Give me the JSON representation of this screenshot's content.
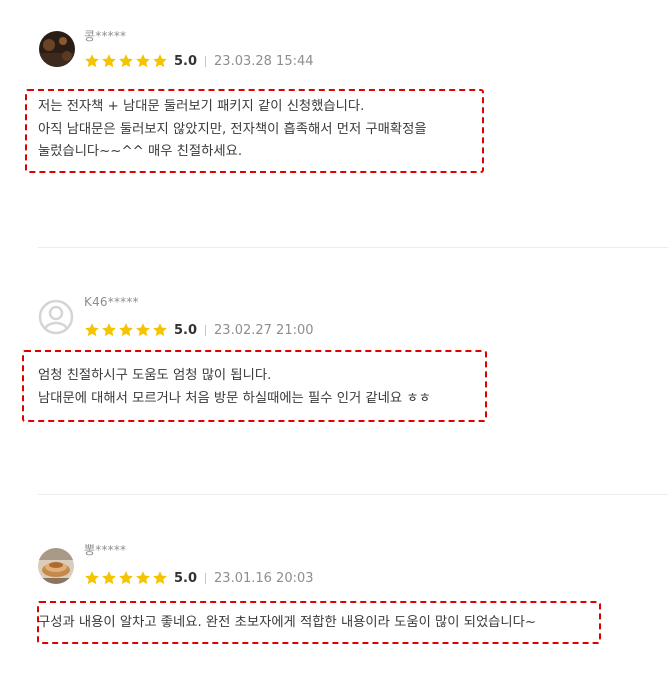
{
  "reviews": [
    {
      "user": "콩*****",
      "avatar": "photo-avatar-icon",
      "rating": 5,
      "score": "5.0",
      "date": "23.03.28 15:44",
      "lines": [
        "저는 전자책 + 남대문 둘러보기 패키지 같이 신청했습니다.",
        "아직 남대문은 둘러보지 않았지만, 전자책이 흡족해서 먼저 구매확정을",
        "눌렀습니다~~^^ 매우 친절하세요."
      ]
    },
    {
      "user": "K46*****",
      "avatar": "default-user-icon",
      "rating": 5,
      "score": "5.0",
      "date": "23.02.27 21:00",
      "lines": [
        "엄청 친절하시구 도움도 엄청 많이 됩니다.",
        "남대문에 대해서 모르거나 처음 방문 하실때에는 필수 인거 같네요 ㅎㅎ"
      ]
    },
    {
      "user": "뽕*****",
      "avatar": "photo-avatar-icon",
      "rating": 5,
      "score": "5.0",
      "date": "23.01.16 20:03",
      "lines": [
        "구성과 내용이 알차고 좋네요. 완전 초보자에게 적합한 내용이라 도움이 많이 되었습니다~"
      ]
    }
  ],
  "colors": {
    "star": "#f5c400",
    "highlight_border": "#e00000",
    "divider": "#ececec"
  }
}
